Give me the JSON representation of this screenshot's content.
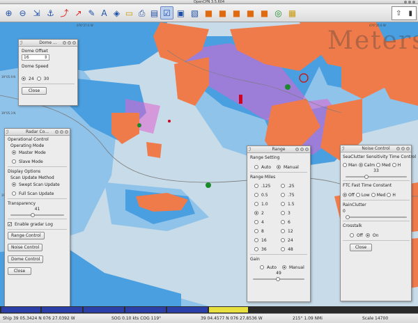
{
  "window": {
    "title": "OpenCPN 3.5.604"
  },
  "toolbar": {
    "icons": [
      "zoom-in-icon",
      "zoom-out-icon",
      "scale-in-icon",
      "scale-out-icon",
      "route-icon",
      "track-icon",
      "measure-icon",
      "text-icon",
      "ais-icon",
      "folder-icon",
      "print-icon",
      "chart-icon",
      "settings-icon",
      "mob-icon",
      "radar-icon",
      "guard-icon",
      "alarm-icon",
      "green-target-icon",
      "yellow-icon"
    ]
  },
  "map": {
    "watermark": "Meters",
    "lat_labels": [
      "39°05.9 N",
      "39°05.6 N",
      "39°05.3 N"
    ],
    "lon_labels": [
      "076°27.0 W",
      "076°26.6 W"
    ]
  },
  "dome_panel": {
    "title": "Dome ...",
    "offset_label": "Dome Offset",
    "offset_value": "16",
    "speed_label": "Dome Speed",
    "speed_options": [
      "24",
      "30"
    ],
    "speed_selected": "24",
    "close_label": "Close"
  },
  "radar_panel": {
    "title": "Radar Co...",
    "section_control": "Operational Control",
    "operating_mode_label": "Operating Mode",
    "master_mode": "Master Mode",
    "slave_mode": "Slave Mode",
    "display_options": "Display Options",
    "scan_update_label": "Scan Update Method",
    "swept_scan": "Swept Scan Update",
    "full_scan": "Full Scan Update",
    "transparency_label": "Transparency",
    "transparency_value": "41",
    "transparency_level": 0.41,
    "enable_log": "Enable gradar Log",
    "range_control": "Range Control",
    "noise_control": "Noise Control",
    "dome_control": "Dome Control",
    "close_label": "Close"
  },
  "range_panel": {
    "title": "Range",
    "setting_label": "Range Setting",
    "auto": "Auto",
    "manual": "Manual",
    "miles_label": "Range Miles",
    "miles_left": [
      ".125",
      "0.5",
      "1.0",
      "2",
      "4",
      "8",
      "16",
      "36"
    ],
    "miles_right": [
      ".25",
      ".75",
      "1.5",
      "3",
      "6",
      "12",
      "24",
      "48"
    ],
    "selected_mile": "2",
    "gain_label": "Gain",
    "gain_auto": "Auto",
    "gain_manual": "Manual",
    "gain_value": "49",
    "gain_level": 0.49
  },
  "noise_panel": {
    "title": "Noise Control",
    "sea_clutter_label": "SeaClutter Sensitivity Time Control",
    "sea_options": [
      "Man",
      "Calm",
      "Med",
      "H"
    ],
    "sea_selected": "Calm",
    "sea_value": "33",
    "sea_level": 0.33,
    "ftc_label": "FTC Fast Time Constant",
    "ftc_options": [
      "Off",
      "Low",
      "Med",
      "H"
    ],
    "ftc_selected": "Off",
    "rain_label": "RainClutter",
    "rain_value": "0",
    "rain_level": 0.0,
    "crosstalk_label": "Crosstalk",
    "crosstalk_off": "Off",
    "crosstalk_on": "On",
    "crosstalk_selected": "On",
    "close_label": "Close"
  },
  "statusbar": {
    "ship": "Ship 39 05.3424 N   076 27.0392 W",
    "sog": "SOG 0.10 kts  COG 119°",
    "cursor": "39 04.4577 N   076 27.8536 W",
    "bearing": "215°  1.09 NMi",
    "scale": "Scale 14700"
  },
  "colors": {
    "land": "#f07b4a",
    "shallow": "#4a9fe0",
    "medium": "#8fc3ea",
    "deep": "#c7dbe8",
    "radar_echo": "#e060d0"
  }
}
